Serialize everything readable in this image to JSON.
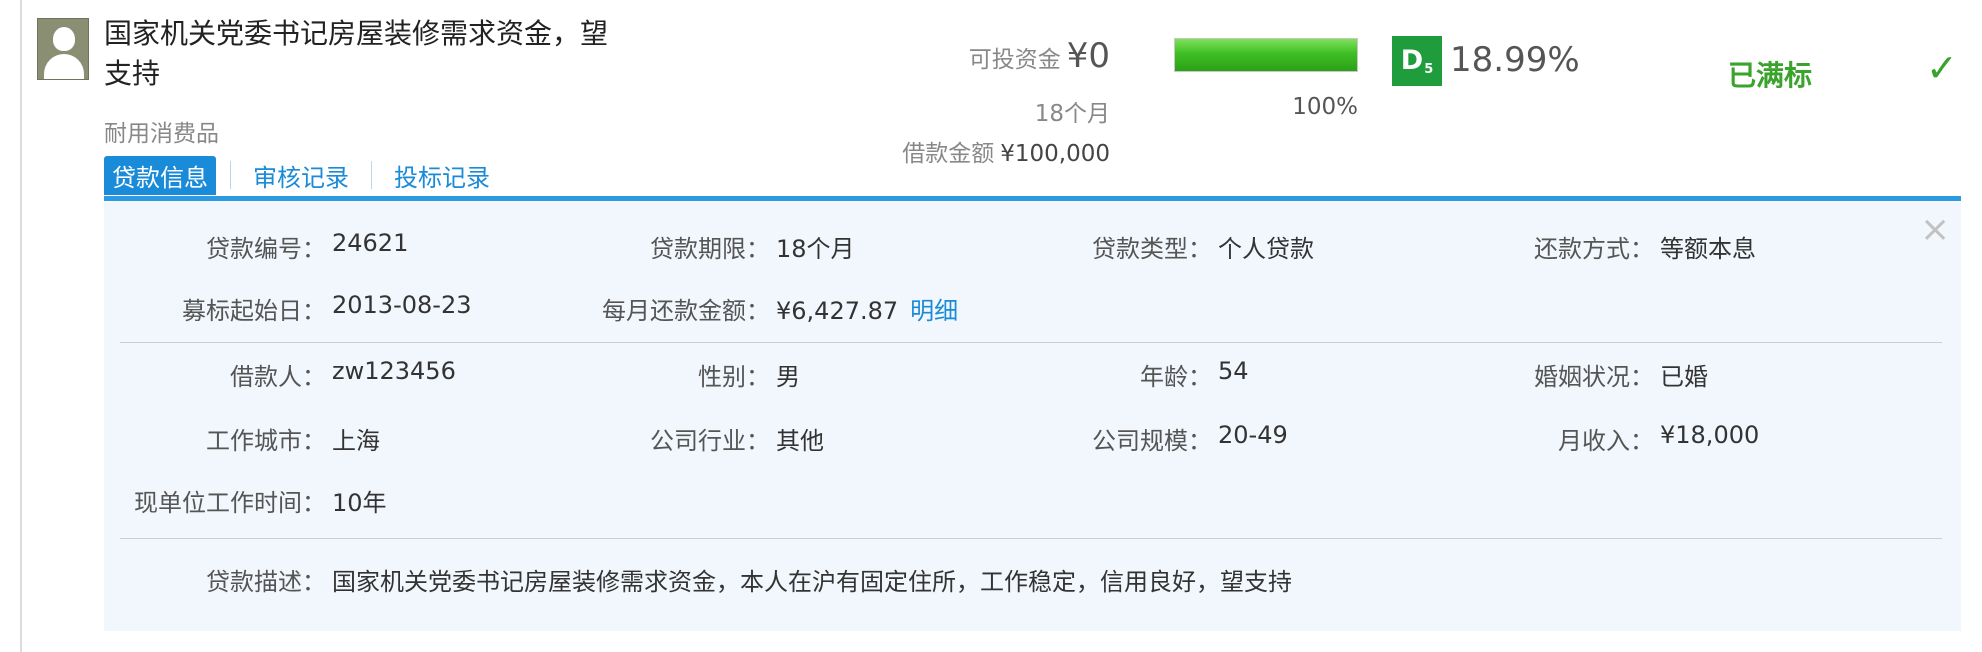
{
  "loan": {
    "title": "国家机关党委书记房屋装修需求资金，望支持",
    "category": "耐用消费品",
    "tabs": [
      "贷款信息",
      "审核记录",
      "投标记录"
    ],
    "investable_label": "可投资金",
    "investable_value": "¥0",
    "term": "18个月",
    "amount_label": "借款金额",
    "amount_value": "¥100,000",
    "progress": 1.0,
    "progress_text": "100%",
    "rating": "D",
    "rating_sub": "5",
    "rate": "18.99%",
    "status": "已满标",
    "colors": {
      "accent": "#1a8bd8",
      "status_green": "#3aa32c",
      "badge_green": "#1f9c3c",
      "progress_green": "#3fbf25"
    }
  },
  "details": {
    "loan_no_label": "贷款编号",
    "loan_no": "24621",
    "period_label": "贷款期限",
    "period": "18个月",
    "type_label": "贷款类型",
    "type": "个人贷款",
    "repay_label": "还款方式",
    "repay": "等额本息",
    "start_label": "募标起始日",
    "start": "2013-08-23",
    "monthly_label": "每月还款金额",
    "monthly": "¥6,427.87",
    "monthly_link": "明细"
  },
  "borrower": {
    "name_label": "借款人",
    "name": "zw123456",
    "gender_label": "性别",
    "gender": "男",
    "age_label": "年龄",
    "age": "54",
    "marital_label": "婚姻状况",
    "marital": "已婚",
    "city_label": "工作城市",
    "city": "上海",
    "industry_label": "公司行业",
    "industry": "其他",
    "size_label": "公司规模",
    "size": "20-49",
    "income_label": "月收入",
    "income": "¥18,000",
    "tenure_label": "现单位工作时间",
    "tenure": "10年"
  },
  "description": {
    "label": "贷款描述",
    "text": "国家机关党委书记房屋装修需求资金，本人在沪有固定住所，工作稳定，信用良好，望支持"
  },
  "icons": {
    "avatar": "user-avatar-icon",
    "check": "check-icon",
    "close": "close-icon"
  }
}
